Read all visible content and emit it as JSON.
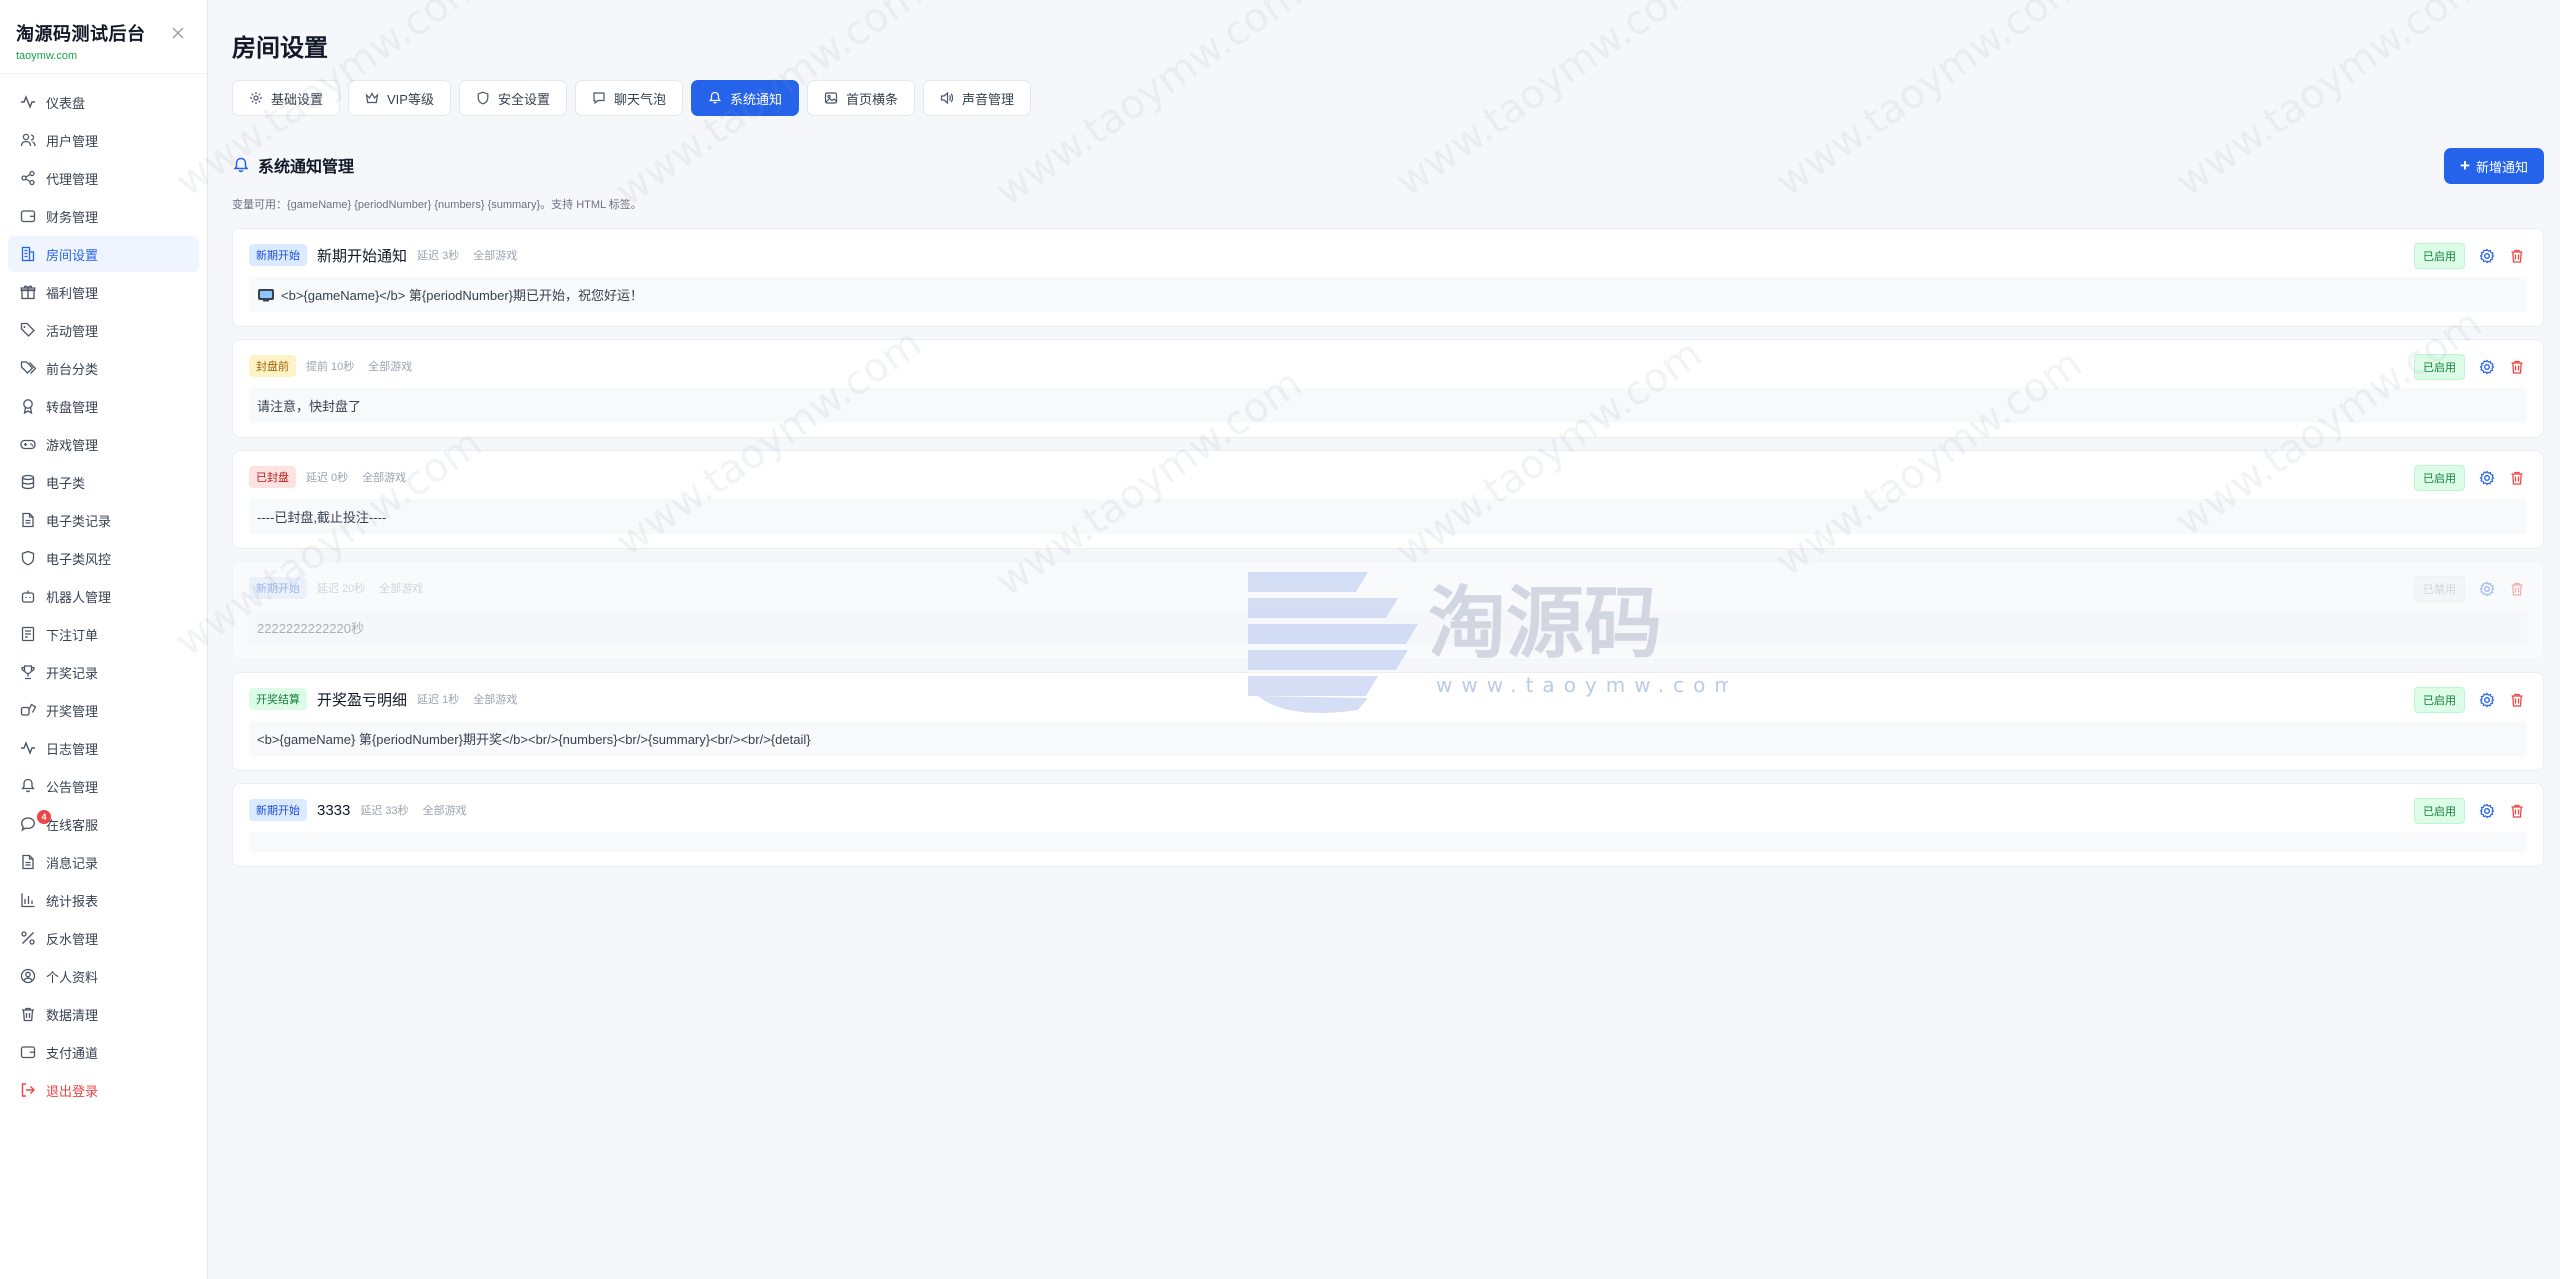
{
  "brand": {
    "title": "淘源码测试后台",
    "subtitle": "taoymw.com"
  },
  "sidebar": {
    "items": [
      {
        "label": "仪表盘",
        "icon": "activity-icon"
      },
      {
        "label": "用户管理",
        "icon": "users-icon"
      },
      {
        "label": "代理管理",
        "icon": "share-icon"
      },
      {
        "label": "财务管理",
        "icon": "wallet-icon"
      },
      {
        "label": "房间设置",
        "icon": "building-icon",
        "active": true
      },
      {
        "label": "福利管理",
        "icon": "gift-icon"
      },
      {
        "label": "活动管理",
        "icon": "tag-icon"
      },
      {
        "label": "前台分类",
        "icon": "tags-icon"
      },
      {
        "label": "转盘管理",
        "icon": "award-icon"
      },
      {
        "label": "游戏管理",
        "icon": "gamepad-icon"
      },
      {
        "label": "电子类",
        "icon": "database-icon"
      },
      {
        "label": "电子类记录",
        "icon": "file-icon"
      },
      {
        "label": "电子类风控",
        "icon": "shield-icon"
      },
      {
        "label": "机器人管理",
        "icon": "bot-icon"
      },
      {
        "label": "下注订单",
        "icon": "receipt-icon"
      },
      {
        "label": "开奖记录",
        "icon": "trophy-icon"
      },
      {
        "label": "开奖管理",
        "icon": "dice-icon"
      },
      {
        "label": "日志管理",
        "icon": "pulse-icon"
      },
      {
        "label": "公告管理",
        "icon": "bell-icon"
      },
      {
        "label": "在线客服",
        "icon": "chat-icon",
        "badge": "4"
      },
      {
        "label": "消息记录",
        "icon": "file-text-icon"
      },
      {
        "label": "统计报表",
        "icon": "bar-chart-icon"
      },
      {
        "label": "反水管理",
        "icon": "percent-icon"
      },
      {
        "label": "个人资料",
        "icon": "user-circle-icon"
      },
      {
        "label": "数据清理",
        "icon": "trash-icon"
      },
      {
        "label": "支付通道",
        "icon": "card-icon"
      },
      {
        "label": "退出登录",
        "icon": "logout-icon",
        "danger": true
      }
    ]
  },
  "page": {
    "title": "房间设置"
  },
  "tabs": [
    {
      "label": "基础设置",
      "icon": "gear-icon"
    },
    {
      "label": "VIP等级",
      "icon": "crown-icon"
    },
    {
      "label": "安全设置",
      "icon": "shield-icon"
    },
    {
      "label": "聊天气泡",
      "icon": "message-icon"
    },
    {
      "label": "系统通知",
      "icon": "bell-icon",
      "active": true
    },
    {
      "label": "首页横条",
      "icon": "image-icon"
    },
    {
      "label": "声音管理",
      "icon": "speaker-icon"
    }
  ],
  "section": {
    "title": "系统通知管理",
    "add_label": "新增通知",
    "vars_hint": "变量可用：{gameName} {periodNumber} {numbers} {summary}。支持 HTML 标签。"
  },
  "notifications": [
    {
      "tag": "新期开始",
      "tag_color": "#1d4ed8",
      "name": "新期开始通知",
      "delay": "延迟 3秒",
      "scope": "全部游戏",
      "status": "已启用",
      "body": "<b>{gameName}</b> 第{periodNumber}期已开始，祝您好运！",
      "has_emoji": true,
      "disabled": false
    },
    {
      "tag": "封盘前",
      "tag_color": "#a16207",
      "name": "",
      "delay": "提前 10秒",
      "scope": "全部游戏",
      "status": "已启用",
      "body": "请注意，快封盘了",
      "has_emoji": false,
      "disabled": false
    },
    {
      "tag": "已封盘",
      "tag_color": "#b91c1c",
      "name": "",
      "delay": "延迟 0秒",
      "scope": "全部游戏",
      "status": "已启用",
      "body": "----已封盘,截止投注----",
      "has_emoji": false,
      "disabled": false
    },
    {
      "tag": "新期开始",
      "tag_color": "#1d4ed8",
      "name": "",
      "delay": "延迟 20秒",
      "scope": "全部游戏",
      "status": "已禁用",
      "body": "2222222222220秒",
      "has_emoji": false,
      "disabled": true
    },
    {
      "tag": "开奖结算",
      "tag_color": "#15803d",
      "name": "开奖盈亏明细",
      "delay": "延迟 1秒",
      "scope": "全部游戏",
      "status": "已启用",
      "body": "<b>{gameName} 第{periodNumber}期开奖</b><br/>{numbers}<br/>{summary}<br/><br/>{detail}",
      "has_emoji": false,
      "disabled": false
    },
    {
      "tag": "新期开始",
      "tag_color": "#1d4ed8",
      "name": "3333",
      "delay": "延迟 33秒",
      "scope": "全部游戏",
      "status": "已启用",
      "body": "",
      "has_emoji": false,
      "disabled": false
    }
  ],
  "watermark": {
    "cn": "淘源码",
    "en": "www.taoymw.com"
  },
  "colors": {
    "accent": "#2563eb",
    "danger": "#ef4444",
    "success": "#15803d"
  }
}
